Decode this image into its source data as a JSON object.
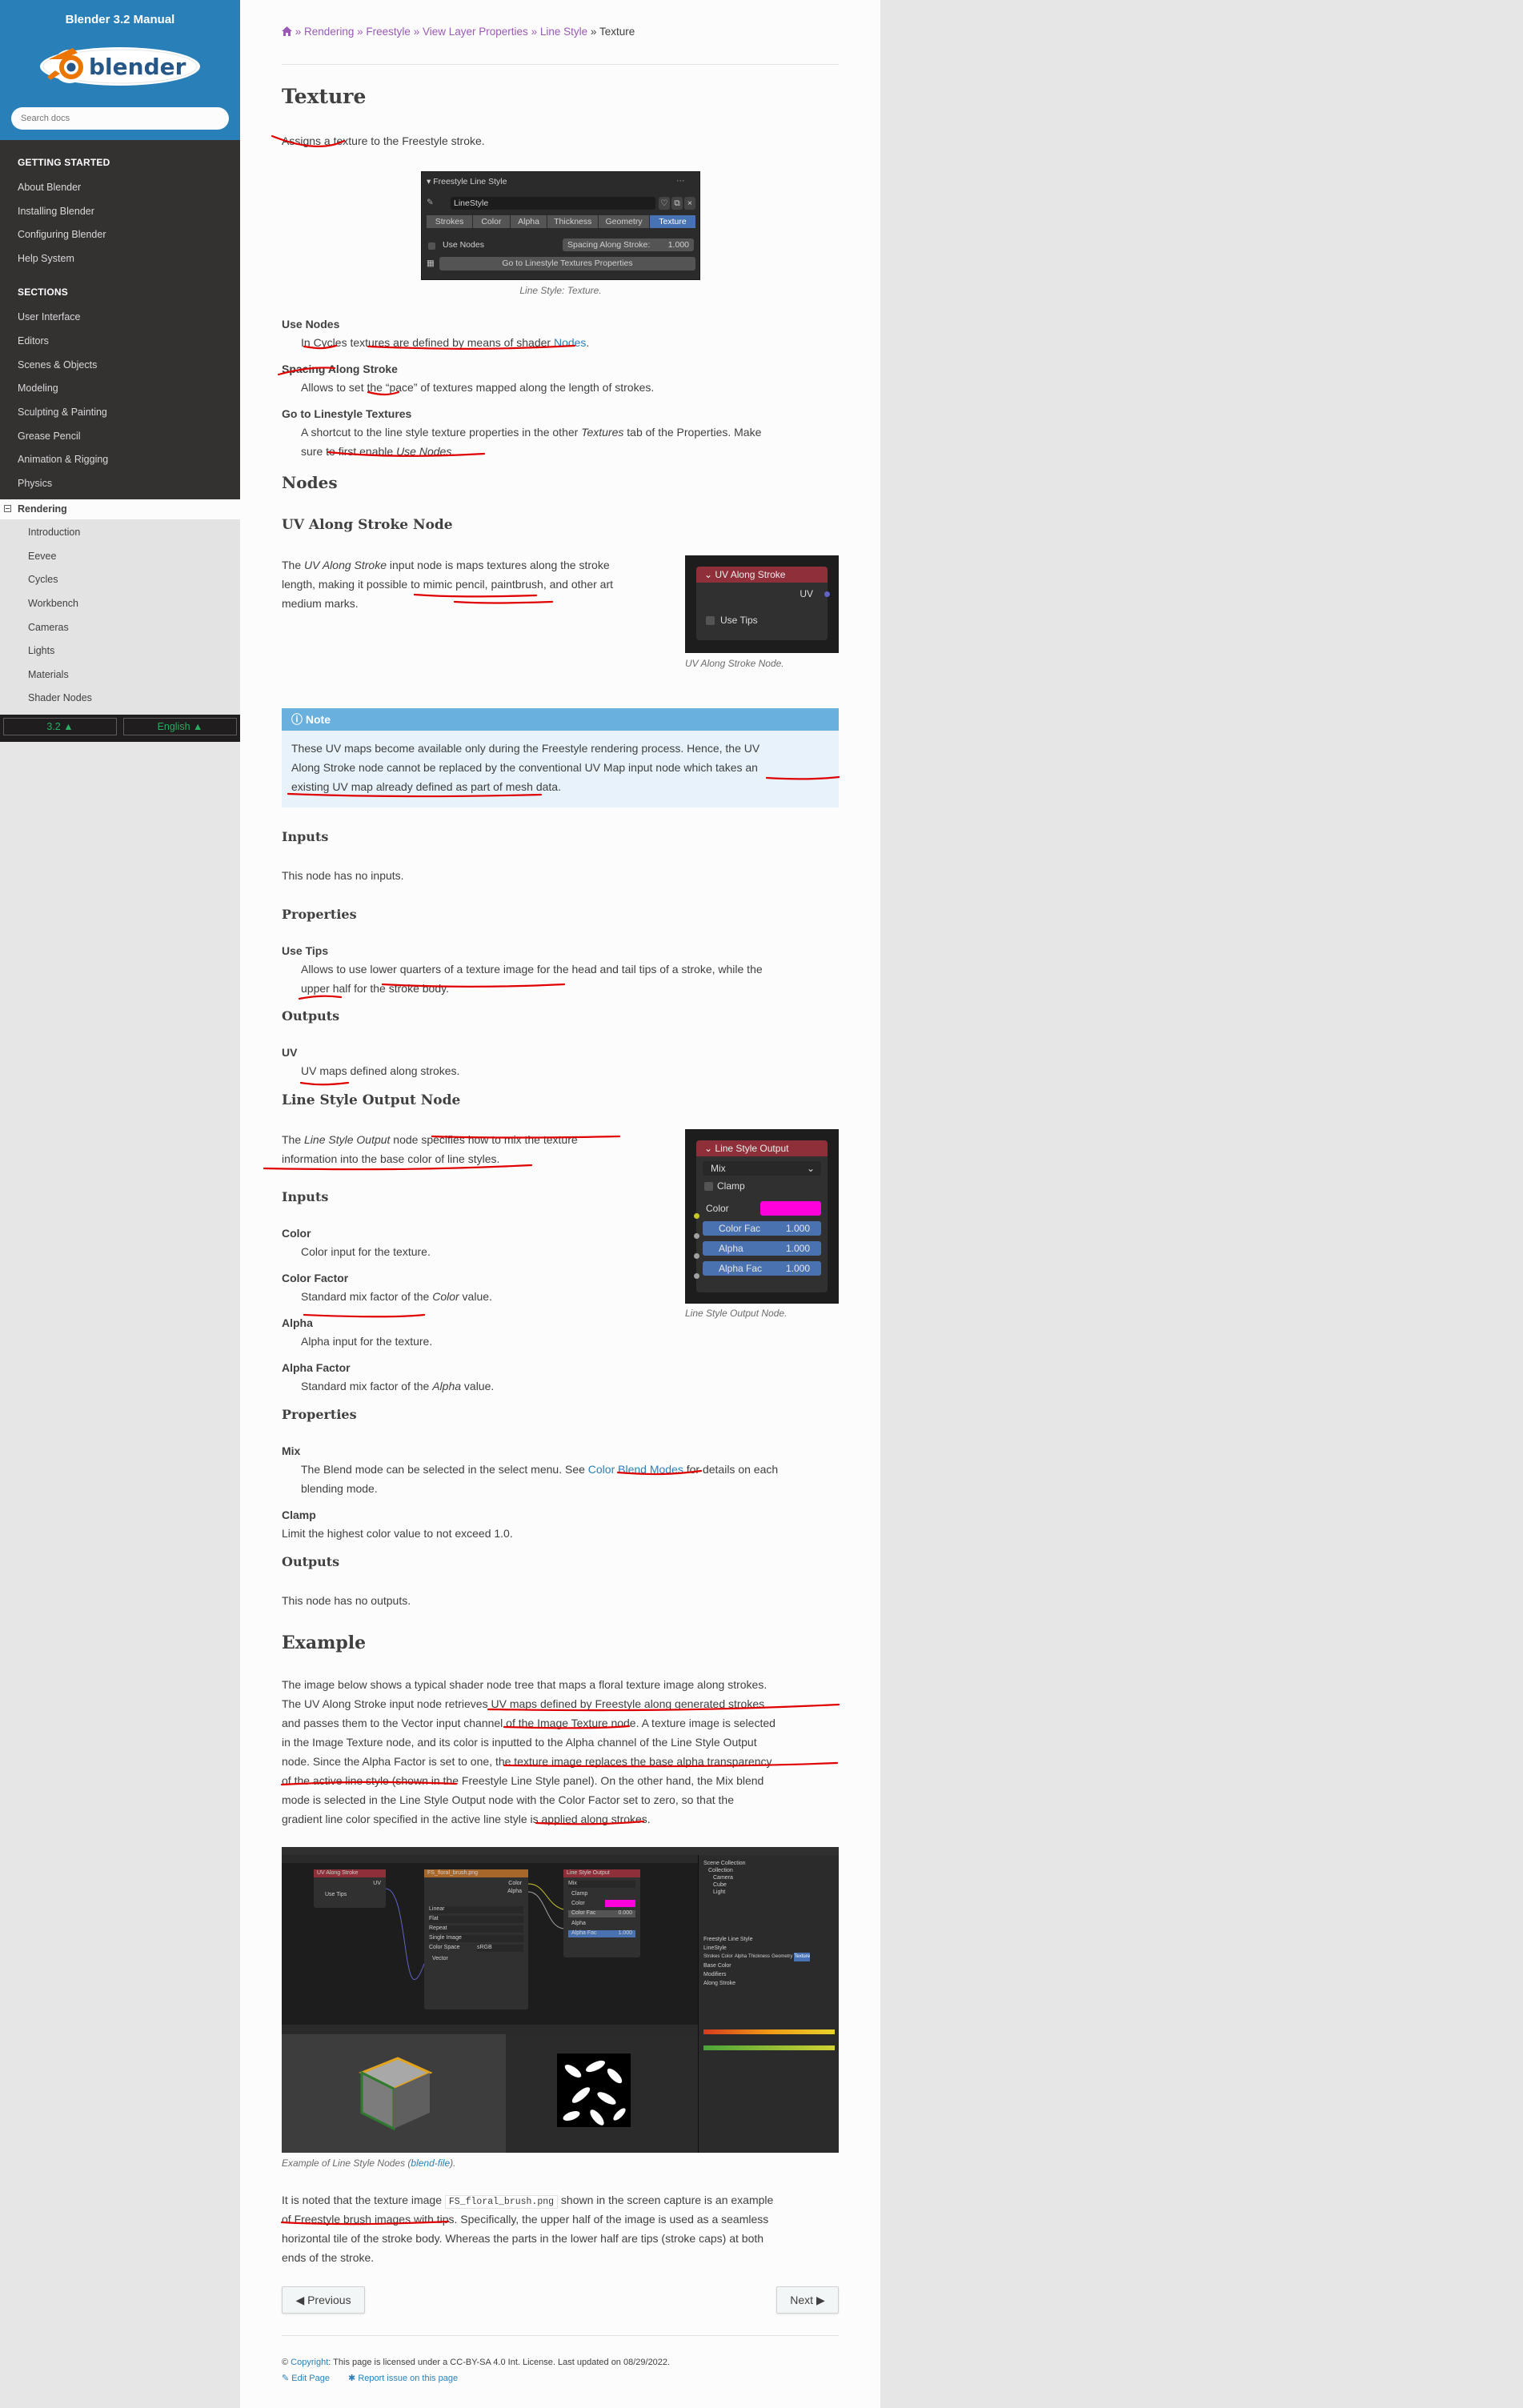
{
  "sidebar": {
    "title": "Blender 3.2 Manual",
    "logo_text": "blender",
    "search_placeholder": "Search docs",
    "getting_started_caption": "GETTING STARTED",
    "getting_started": [
      "About Blender",
      "Installing Blender",
      "Configuring Blender",
      "Help System"
    ],
    "sections_caption": "SECTIONS",
    "sections": [
      "User Interface",
      "Editors",
      "Scenes & Objects",
      "Modeling",
      "Sculpting & Painting",
      "Grease Pencil",
      "Animation & Rigging",
      "Physics"
    ],
    "current": "Rendering",
    "sub_items": [
      "Introduction",
      "Eevee",
      "Cycles",
      "Workbench",
      "Cameras",
      "Lights",
      "Materials",
      "Shader Nodes"
    ],
    "version": "3.2",
    "language": "English"
  },
  "breadcrumb": [
    "Rendering",
    "Freestyle",
    "View Layer Properties",
    "Line Style",
    "Texture"
  ],
  "page": {
    "title": "Texture",
    "intro": "Assigns a texture to the Freestyle stroke.",
    "fig1_caption": "Line Style: Texture.",
    "fig1": {
      "header": "Freestyle Line Style",
      "linestyle_name": "LineStyle",
      "tabs": [
        "Strokes",
        "Color",
        "Alpha",
        "Thickness",
        "Geometry",
        "Texture"
      ],
      "use_nodes": "Use Nodes",
      "spacing_label": "Spacing Along Stroke:",
      "spacing_value": "1.000",
      "go_button": "Go to Linestyle Textures Properties"
    },
    "use_nodes_term": "Use Nodes",
    "use_nodes_desc_pre": "In Cycles textures are defined by means of shader ",
    "use_nodes_desc_link": "Nodes",
    "use_nodes_desc_post": ".",
    "spacing_term": "Spacing Along Stroke",
    "spacing_desc": "Allows to set the “pace” of textures mapped along the length of strokes.",
    "goto_term": "Go to Linestyle Textures",
    "goto_desc_1": "A shortcut to the line style texture properties in the other ",
    "goto_desc_em": "Textures",
    "goto_desc_2": " tab of the Properties. Make",
    "goto_desc_3": "sure to first enable ",
    "goto_desc_em2": "Use Nodes",
    "goto_desc_4": ".",
    "nodes_heading": "Nodes",
    "uv_heading": "UV Along Stroke Node",
    "uv_p1_pre": "The ",
    "uv_p1_em": "UV Along Stroke",
    "uv_p1_post": " input node is maps textures along the stroke",
    "uv_p2": "length, making it possible to mimic pencil, paintbrush, and other art",
    "uv_p3": "medium marks.",
    "uv_node": {
      "header": "UV Along Stroke",
      "output": "UV",
      "checkbox": "Use Tips"
    },
    "uv_caption": "UV Along Stroke Node.",
    "note_title": "Note",
    "note_l1": "These UV maps become available only during the Freestyle rendering process. Hence, the UV",
    "note_l2": "Along Stroke node cannot be replaced by the conventional UV Map input node which takes an",
    "note_l3": "existing UV map already defined as part of mesh data.",
    "inputs_heading": "Inputs",
    "no_inputs": "This node has no inputs.",
    "properties_heading": "Properties",
    "use_tips_term": "Use Tips",
    "use_tips_l1": "Allows to use lower quarters of a texture image for the head and tail tips of a stroke, while the",
    "use_tips_l2": "upper half for the stroke body.",
    "outputs_heading": "Outputs",
    "uv_term": "UV",
    "uv_desc": "UV maps defined along strokes.",
    "lso_heading": "Line Style Output Node",
    "lso_p1_pre": "The ",
    "lso_p1_em": "Line Style Output",
    "lso_p1_post": " node specifies how to mix the texture",
    "lso_p2": "information into the base color of line styles.",
    "lso_node": {
      "header": "Line Style Output",
      "mix": "Mix",
      "clamp": "Clamp",
      "color": "Color",
      "color_fac": "Color Fac",
      "color_fac_value": "1.000",
      "alpha": "Alpha",
      "alpha_value": "1.000",
      "alpha_fac": "Alpha Fac",
      "alpha_fac_value": "1.000",
      "swatch_color": "#ff00dd"
    },
    "lso_caption": "Line Style Output Node.",
    "lso_inputs_heading": "Inputs",
    "color_term": "Color",
    "color_desc": "Color input for the texture.",
    "color_factor_term": "Color Factor",
    "color_factor_desc_pre": "Standard mix factor of the ",
    "color_factor_desc_em": "Color",
    "color_factor_desc_post": " value.",
    "alpha_term": "Alpha",
    "alpha_desc": "Alpha input for the texture.",
    "alpha_factor_term": "Alpha Factor",
    "alpha_factor_desc_pre": "Standard mix factor of the ",
    "alpha_factor_desc_em": "Alpha",
    "alpha_factor_desc_post": " value.",
    "lso_properties_heading": "Properties",
    "mix_term": "Mix",
    "mix_desc_pre": "The Blend mode can be selected in the select menu. See ",
    "mix_desc_link": "Color Blend Modes",
    "mix_desc_post": " for details on each",
    "mix_desc_l2": "blending mode.",
    "clamp_term": "Clamp",
    "clamp_desc": "Limit the highest color value to not exceed 1.0.",
    "lso_outputs_heading": "Outputs",
    "no_outputs": "This node has no outputs.",
    "example_heading": "Example",
    "ex_l1": "The image below shows a typical shader node tree that maps a floral texture image along strokes.",
    "ex_l2": "The UV Along Stroke input node retrieves UV maps defined by Freestyle along generated strokes",
    "ex_l3": "and passes them to the Vector input channel of the Image Texture node. A texture image is selected",
    "ex_l4": "in the Image Texture node, and its color is inputted to the Alpha channel of the Line Style Output",
    "ex_l5": "node. Since the Alpha Factor is set to one, the texture image replaces the base alpha transparency",
    "ex_l6": "of the active line style (shown in the Freestyle Line Style panel). On the other hand, the Mix blend",
    "ex_l7": "mode is selected in the Line Style Output node with the Color Factor set to zero, so that the",
    "ex_l8": "gradient line color specified in the active line style is applied along strokes.",
    "screenshot": {
      "uv_node": "UV Along Stroke",
      "img_node": "FS_floral_brush.png",
      "lso_node": "Line Style Output",
      "uv_out": "UV",
      "use_tips": "Use Tips",
      "img_color": "Color",
      "img_alpha": "Alpha",
      "img_opts": [
        "Linear",
        "Flat",
        "Repeat",
        "Single Image",
        "Color Space",
        "Vector"
      ],
      "img_colorspace": "sRGB",
      "lso_mix": "Mix",
      "lso_clamp": "Clamp",
      "lso_color": "Color",
      "lso_colorfac": "Color Fac",
      "lso_colorfac_value": "0.000",
      "lso_alpha": "Alpha",
      "lso_alphafac": "Alpha Fac",
      "lso_alphafac_value": "1.000",
      "outliner": [
        "Scene Collection",
        "Collection",
        "Camera",
        "Cube",
        "Light"
      ],
      "props_rows": [
        "Freestyle Line Style",
        "LineStyle",
        "Strokes",
        "Color",
        "Alpha",
        "Thickness",
        "Geometry",
        "Texture",
        "Base Color",
        "Modifiers",
        "Along Stroke"
      ]
    },
    "ex_caption_pre": "Example of Line Style Nodes (",
    "ex_caption_link": "blend-file",
    "ex_caption_post": ").",
    "final_l1_pre": "It is noted that the texture image ",
    "final_l1_code": "FS_floral_brush.png",
    "final_l1_post": " shown in the screen capture is an example",
    "final_l2": "of Freestyle brush images with tips. Specifically, the upper half of the image is used as a seamless",
    "final_l3": "horizontal tile of the stroke body. Whereas the parts in the lower half are tips (stroke caps) at both",
    "final_l4": "ends of the stroke."
  },
  "nav": {
    "previous": "Previous",
    "next": "Next"
  },
  "footer": {
    "copyright_link": "Copyright",
    "license": ": This page is licensed under a CC-BY-SA 4.0 Int. License. Last updated on 08/29/2022.",
    "edit_page": "Edit Page",
    "report_issue": "Report issue on this page"
  },
  "colors": {
    "sidebar_header": "#2980b9",
    "sidebar_bg": "#343131",
    "link": "#2980b9",
    "breadcrumb_link": "#9b59b6",
    "note_header": "#6ab0de",
    "note_bg": "#e7f2fa",
    "annotation_red": "#e00000",
    "version_green": "#27ae60"
  }
}
